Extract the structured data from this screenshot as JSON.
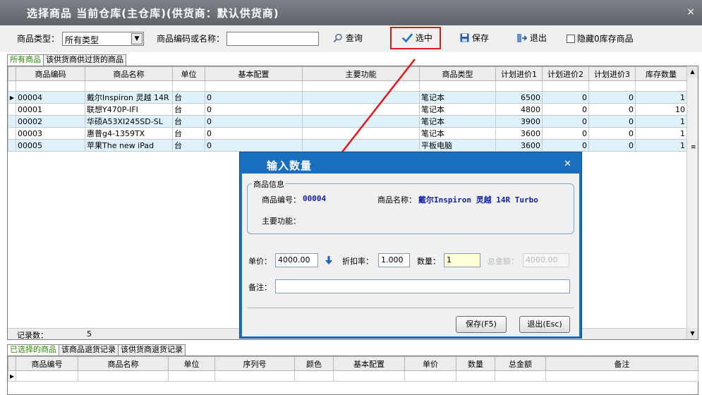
{
  "window": {
    "title": "选择商品  当前仓库(主仓库)(供货商：默认供货商)",
    "close_glyph": "×"
  },
  "toolbar": {
    "type_label": "商品类型：",
    "type_value": "所有类型",
    "code_label": "商品编码或名称：",
    "code_value": "",
    "query_label": "查询",
    "select_label": "选中",
    "save_label": "保存",
    "exit_label": "退出",
    "hide_zero_label": "隐藏0库存商品"
  },
  "top_tabs": [
    "所有商品",
    "该供货商供过货的商品"
  ],
  "product_grid": {
    "columns": [
      "商品编码",
      "商品名称",
      "单位",
      "基本配置",
      "主要功能",
      "商品类型",
      "计划进价1",
      "计划进价2",
      "计划进价3",
      "库存数量"
    ],
    "rows": [
      [
        "00004",
        "戴尔Inspiron 灵越 14R",
        "台",
        "0",
        "",
        "笔记本",
        "6500",
        "0",
        "0",
        "1"
      ],
      [
        "00001",
        "联想Y470P-IFI",
        "台",
        "0",
        "",
        "笔记本",
        "4800",
        "0",
        "0",
        "10"
      ],
      [
        "00002",
        "华硕A53XI245SD-SL",
        "台",
        "0",
        "",
        "笔记本",
        "3900",
        "0",
        "0",
        "1"
      ],
      [
        "00003",
        "惠普g4-1359TX",
        "台",
        "0",
        "",
        "笔记本",
        "3600",
        "0",
        "0",
        "1"
      ],
      [
        "00005",
        "苹果The new iPad",
        "台",
        "0",
        "",
        "平板电脑",
        "3600",
        "0",
        "0",
        "1"
      ]
    ],
    "record_label": "记录数：",
    "record_count": "5"
  },
  "bottom_tabs": [
    "已选择的商品",
    "该商品退货记录",
    "该供货商退货记录"
  ],
  "selected_grid": {
    "columns": [
      "商品编号",
      "商品名称",
      "单位",
      "序列号",
      "颜色",
      "基本配置",
      "单价",
      "数量",
      "总金额",
      "备注"
    ]
  },
  "dialog": {
    "title": "输入数量",
    "group_title": "商品信息",
    "code_label": "商品编号：",
    "code_value": "00004",
    "name_label": "商品名称：",
    "name_value": "戴尔Inspiron 灵越 14R Turbo",
    "function_label": "主要功能：",
    "price_label": "单价：",
    "price_value": "4000.00",
    "discount_label": "折扣率：",
    "discount_value": "1.000",
    "qty_label": "数量：",
    "qty_value": "1",
    "total_label": "总金额：",
    "total_value": "4000.00",
    "remark_label": "备注：",
    "remark_value": "",
    "save_button": "保存(F5)",
    "exit_button": "退出(Esc)"
  },
  "colors": {
    "accent": "#1a6ec0",
    "highlight_red": "#e01818",
    "row_alt": "#dff1fb"
  }
}
